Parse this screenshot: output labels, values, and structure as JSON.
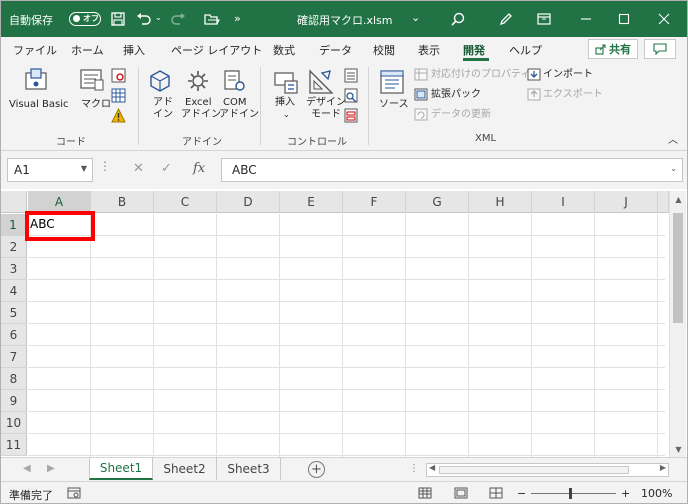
{
  "titlebar": {
    "autosave_label": "自動保存",
    "autosave_state": "オフ",
    "filename": "確認用マクロ.xlsm",
    "filename_suffix": "⌄"
  },
  "menu": {
    "items": [
      "ファイル",
      "ホーム",
      "挿入",
      "ページ レイアウト",
      "数式",
      "データ",
      "校閲",
      "表示",
      "開発",
      "ヘルプ"
    ],
    "active_index": 8,
    "share_label": "共有"
  },
  "ribbon": {
    "code_group": {
      "label": "コード",
      "visual_basic": "Visual Basic",
      "macro": "マクロ"
    },
    "addin_group": {
      "label": "アドイン",
      "addin_line1": "アド",
      "addin_line2": "イン",
      "excel_addin_line1": "Excel",
      "excel_addin_line2": "アドイン",
      "com_addin_line1": "COM",
      "com_addin_line2": "アドイン"
    },
    "control_group": {
      "label": "コントロール",
      "insert": "挿入",
      "insert_caret": "⌄",
      "design_line1": "デザイン",
      "design_line2": "モード"
    },
    "xml_group": {
      "label": "XML",
      "source": "ソース",
      "map_properties": "対応付けのプロパティ",
      "expansion_packs": "拡張パック",
      "refresh_data": "データの更新",
      "import": "インポート",
      "export": "エクスポート"
    }
  },
  "formula_bar": {
    "name_box": "A1",
    "fx": "fx",
    "value": "ABC"
  },
  "grid": {
    "columns": [
      "A",
      "B",
      "C",
      "D",
      "E",
      "F",
      "G",
      "H",
      "I",
      "J"
    ],
    "rows": [
      "1",
      "2",
      "3",
      "4",
      "5",
      "6",
      "7",
      "8",
      "9",
      "10",
      "11"
    ],
    "selected_column": "A",
    "selected_row": "1",
    "a1_value": "ABC"
  },
  "sheets": {
    "tabs": [
      "Sheet1",
      "Sheet2",
      "Sheet3"
    ],
    "active_index": 0,
    "add_label": "+"
  },
  "status": {
    "ready": "準備完了",
    "zoom_minus": "−",
    "zoom_plus": "+",
    "zoom_pct": "100%"
  },
  "colors": {
    "accent": "#217346",
    "highlight": "#ff0000"
  }
}
